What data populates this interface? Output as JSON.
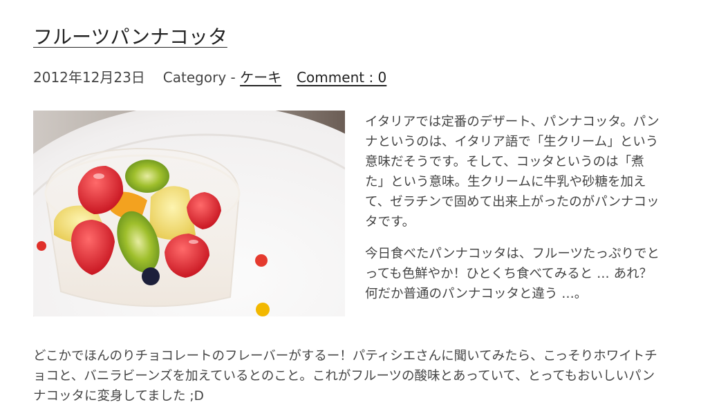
{
  "post": {
    "title": "フルーツパンナコッタ",
    "date": "2012年12月23日",
    "category_prefix": "Category - ",
    "category": "ケーキ",
    "comment": "Comment : 0",
    "paragraph1": "イタリアでは定番のデザート、パンナコッタ。パンナというのは、イタリア語で「生クリーム」という意味だそうです。そして、コッタというのは「煮た」という意味。生クリームに牛乳や砂糖を加えて、ゼラチンで固めて出来上がったのがパンナコッタです。",
    "paragraph2": "今日食べたパンナコッタは、フルーツたっぷりでとっても色鮮やか！ひとくち食べてみると … あれ？何だか普通のパンナコッタと違う …。",
    "paragraph3": "どこかでほんのりチョコレートのフレーバーがするー！パティシエさんに聞いてみたら、こっそりホワイトチョコと、バニラビーンズを加えているとのこと。これがフルーツの酸味とあっていて、とってもおいしいパンナコッタに変身してました ;D"
  },
  "colors": {
    "text": "#444444",
    "title": "#222222",
    "background": "#ffffff"
  }
}
